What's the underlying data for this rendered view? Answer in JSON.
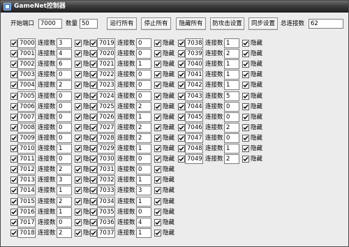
{
  "window": {
    "title": "GameNet控制器"
  },
  "toolbar": {
    "start_port_label": "开始端口",
    "start_port_value": "7000",
    "count_label": "数量",
    "count_value": "50",
    "run_all": "运行所有",
    "stop_all": "停止所有",
    "hide_all": "隐藏所有",
    "anti_attack": "防攻击设置",
    "sync": "同步设置",
    "total_label": "总连接数",
    "total_value": "62"
  },
  "labels": {
    "conn": "连接数",
    "hide": "隐藏"
  },
  "columns": [
    [
      {
        "port": "7000",
        "conn": "3",
        "checked": true,
        "hidden": true
      },
      {
        "port": "7001",
        "conn": "4",
        "checked": true,
        "hidden": true
      },
      {
        "port": "7002",
        "conn": "6",
        "checked": true,
        "hidden": true
      },
      {
        "port": "7003",
        "conn": "0",
        "checked": true,
        "hidden": true
      },
      {
        "port": "7004",
        "conn": "2",
        "checked": true,
        "hidden": true
      },
      {
        "port": "7005",
        "conn": "0",
        "checked": true,
        "hidden": true
      },
      {
        "port": "7006",
        "conn": "0",
        "checked": true,
        "hidden": true
      },
      {
        "port": "7007",
        "conn": "0",
        "checked": true,
        "hidden": true
      },
      {
        "port": "7008",
        "conn": "0",
        "checked": true,
        "hidden": true
      },
      {
        "port": "7009",
        "conn": "0",
        "checked": true,
        "hidden": true
      },
      {
        "port": "7010",
        "conn": "1",
        "checked": true,
        "hidden": true
      },
      {
        "port": "7011",
        "conn": "0",
        "checked": true,
        "hidden": true
      },
      {
        "port": "7012",
        "conn": "2",
        "checked": true,
        "hidden": true
      },
      {
        "port": "7013",
        "conn": "3",
        "checked": true,
        "hidden": true
      },
      {
        "port": "7014",
        "conn": "1",
        "checked": true,
        "hidden": true
      },
      {
        "port": "7015",
        "conn": "2",
        "checked": true,
        "hidden": true
      },
      {
        "port": "7016",
        "conn": "1",
        "checked": true,
        "hidden": true
      },
      {
        "port": "7017",
        "conn": "0",
        "checked": true,
        "hidden": true
      },
      {
        "port": "7018",
        "conn": "2",
        "checked": true,
        "hidden": true
      }
    ],
    [
      {
        "port": "7019",
        "conn": "0",
        "checked": true,
        "hidden": true
      },
      {
        "port": "7020",
        "conn": "0",
        "checked": true,
        "hidden": true
      },
      {
        "port": "7021",
        "conn": "1",
        "checked": true,
        "hidden": true
      },
      {
        "port": "7022",
        "conn": "0",
        "checked": true,
        "hidden": true
      },
      {
        "port": "7023",
        "conn": "0",
        "checked": true,
        "hidden": true
      },
      {
        "port": "7024",
        "conn": "0",
        "checked": true,
        "hidden": true
      },
      {
        "port": "7025",
        "conn": "2",
        "checked": true,
        "hidden": true
      },
      {
        "port": "7026",
        "conn": "1",
        "checked": true,
        "hidden": true
      },
      {
        "port": "7027",
        "conn": "2",
        "checked": true,
        "hidden": true
      },
      {
        "port": "7028",
        "conn": "2",
        "checked": true,
        "hidden": true
      },
      {
        "port": "7029",
        "conn": "1",
        "checked": true,
        "hidden": true
      },
      {
        "port": "7030",
        "conn": "0",
        "checked": true,
        "hidden": true
      },
      {
        "port": "7031",
        "conn": "0",
        "checked": true,
        "hidden": true
      },
      {
        "port": "7032",
        "conn": "1",
        "checked": true,
        "hidden": true
      },
      {
        "port": "7033",
        "conn": "3",
        "checked": true,
        "hidden": true
      },
      {
        "port": "7034",
        "conn": "1",
        "checked": true,
        "hidden": true
      },
      {
        "port": "7035",
        "conn": "0",
        "checked": true,
        "hidden": true
      },
      {
        "port": "7036",
        "conn": "4",
        "checked": true,
        "hidden": true
      },
      {
        "port": "7037",
        "conn": "1",
        "checked": true,
        "hidden": true
      }
    ],
    [
      {
        "port": "7038",
        "conn": "1",
        "checked": true,
        "hidden": true
      },
      {
        "port": "7039",
        "conn": "2",
        "checked": true,
        "hidden": true
      },
      {
        "port": "7040",
        "conn": "1",
        "checked": true,
        "hidden": true
      },
      {
        "port": "7041",
        "conn": "1",
        "checked": true,
        "hidden": true
      },
      {
        "port": "7042",
        "conn": "1",
        "checked": true,
        "hidden": true
      },
      {
        "port": "7043",
        "conn": "5",
        "checked": true,
        "hidden": true
      },
      {
        "port": "7044",
        "conn": "0",
        "checked": true,
        "hidden": true
      },
      {
        "port": "7045",
        "conn": "0",
        "checked": true,
        "hidden": true
      },
      {
        "port": "7046",
        "conn": "2",
        "checked": true,
        "hidden": true
      },
      {
        "port": "7047",
        "conn": "0",
        "checked": true,
        "hidden": true
      },
      {
        "port": "7048",
        "conn": "1",
        "checked": true,
        "hidden": true
      },
      {
        "port": "7049",
        "conn": "2",
        "checked": true,
        "hidden": true
      }
    ]
  ]
}
